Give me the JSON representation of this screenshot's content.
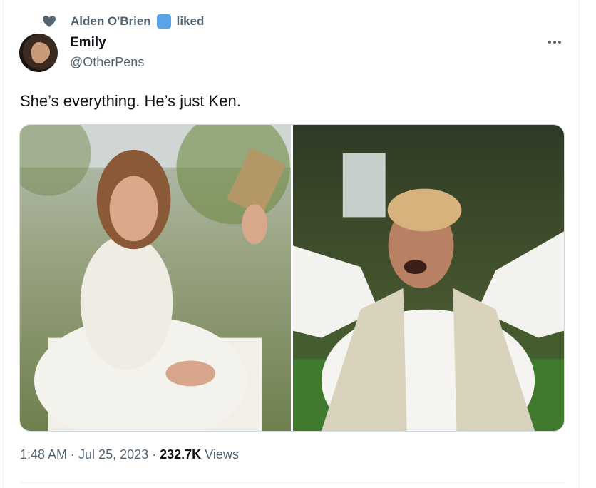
{
  "social_context": {
    "user": "Alden O'Brien",
    "action": "liked"
  },
  "author": {
    "display_name": "Emily",
    "handle": "@OtherPens"
  },
  "tweet": {
    "text": "She’s everything. He’s just Ken."
  },
  "meta": {
    "time": "1:48 AM",
    "separator": "·",
    "date": "Jul 25, 2023",
    "views_count": "232.7K",
    "views_label": "Views"
  },
  "colors": {
    "text_primary": "#0f1419",
    "text_secondary": "#536471",
    "verified_badge": "#5aa3e6",
    "border": "#cfd9de"
  },
  "icons": {
    "liked": "heart-icon",
    "verified": "verified-badge-icon",
    "more": "more-dots-icon"
  }
}
